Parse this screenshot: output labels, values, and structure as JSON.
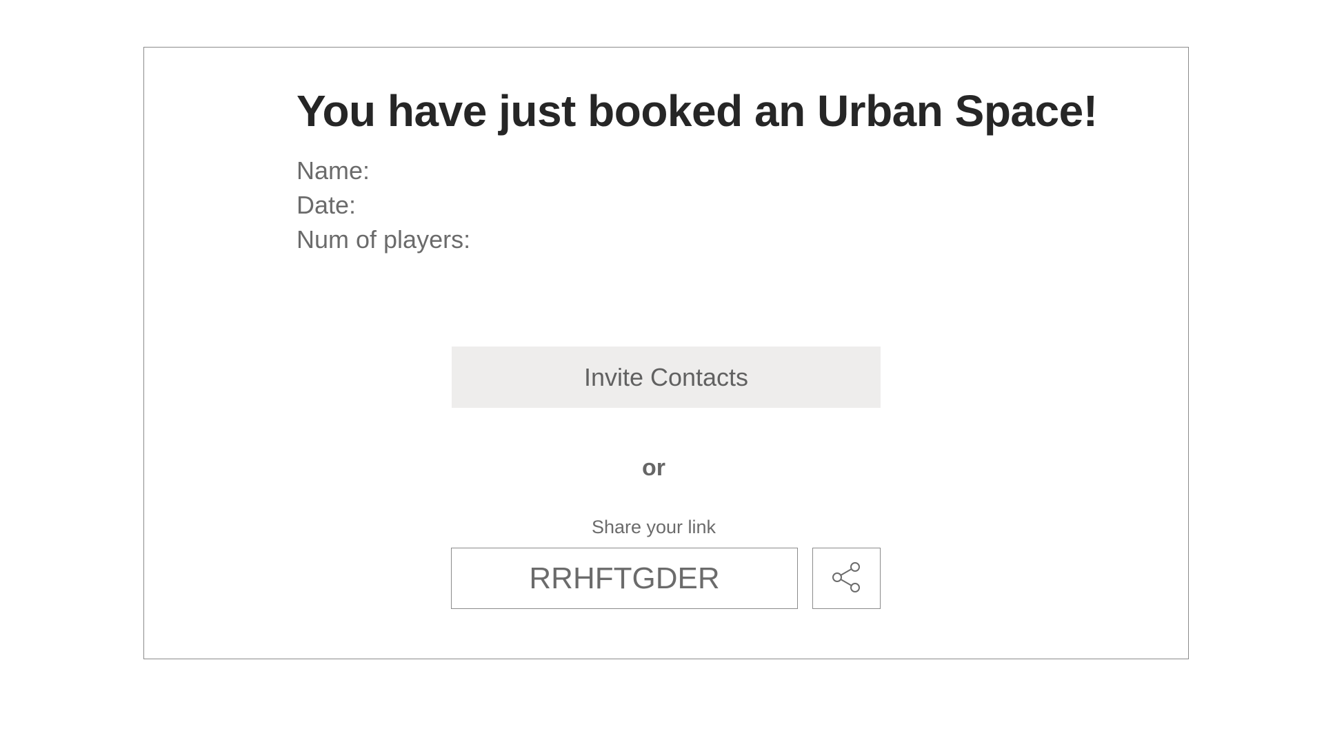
{
  "booking": {
    "title": "You have just booked an Urban Space!",
    "name_label": "Name:",
    "date_label": "Date:",
    "players_label": "Num of players:"
  },
  "actions": {
    "invite_label": "Invite Contacts",
    "or_text": "or",
    "share_caption": "Share your link",
    "link_code": "RRHFTGDER",
    "share_icon": "share-icon"
  },
  "colors": {
    "title": "#262626",
    "text": "#6b6b6b",
    "button_bg": "#eeedec",
    "border": "#8a8a8a"
  }
}
